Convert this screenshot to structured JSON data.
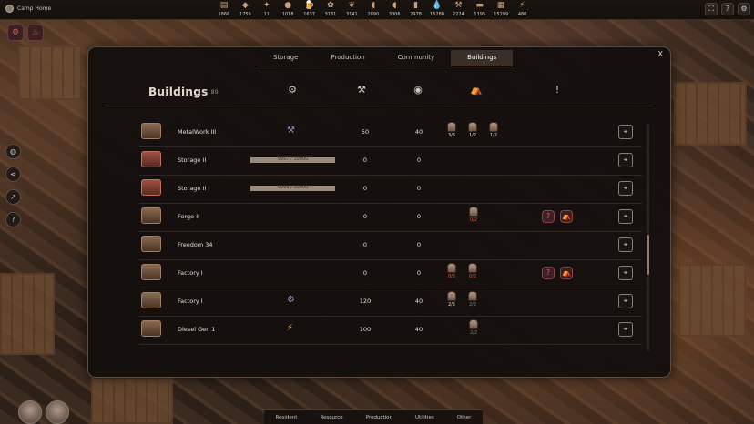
{
  "camp": {
    "name": "Camp Home",
    "icon": "camp-icon"
  },
  "resources": [
    {
      "icon": "wood-icon",
      "value": "1866"
    },
    {
      "icon": "stone-icon",
      "value": "1759"
    },
    {
      "icon": "ore-icon",
      "value": "11"
    },
    {
      "icon": "food-icon",
      "value": "1018"
    },
    {
      "icon": "beer-icon",
      "value": "1637"
    },
    {
      "icon": "herb-icon",
      "value": "3131"
    },
    {
      "icon": "plant-icon",
      "value": "3141"
    },
    {
      "icon": "meat-icon",
      "value": "2890"
    },
    {
      "icon": "meat-icon",
      "value": "3006"
    },
    {
      "icon": "bottle-icon",
      "value": "2978"
    },
    {
      "icon": "water-icon",
      "value": "15280"
    },
    {
      "icon": "tools-icon",
      "value": "2224"
    },
    {
      "icon": "brick-icon",
      "value": "1195"
    },
    {
      "icon": "cloth-icon",
      "value": "15299"
    },
    {
      "icon": "energy-icon",
      "value": "480"
    }
  ],
  "tabs": [
    "Storage",
    "Production",
    "Community",
    "Buildings"
  ],
  "active_tab": "Buildings",
  "panel": {
    "title": "Buildings",
    "count": "89",
    "close_label": "X"
  },
  "rows": [
    {
      "name": "MetalWork III",
      "icon": "metalwork-icon",
      "type_icon": "hammer-pick-icon",
      "bar": null,
      "val1": "50",
      "val2": "40",
      "workers": [
        {
          "label": "3/6",
          "style": "normal"
        },
        {
          "label": "1/2",
          "style": "normal"
        },
        {
          "label": "1/2",
          "style": "normal"
        }
      ],
      "alerts": []
    },
    {
      "name": "Storage II",
      "icon": "storage-icon",
      "type_icon": null,
      "bar": {
        "label": "9957 / 10000",
        "fraction": 0.9957
      },
      "val1": "0",
      "val2": "0",
      "workers": [],
      "alerts": []
    },
    {
      "name": "Storage II",
      "icon": "storage-icon",
      "type_icon": null,
      "bar": {
        "label": "9999 / 10000",
        "fraction": 0.9999
      },
      "val1": "0",
      "val2": "0",
      "workers": [],
      "alerts": []
    },
    {
      "name": "Forge II",
      "icon": "forge-icon",
      "type_icon": null,
      "bar": null,
      "val1": "0",
      "val2": "0",
      "workers": [
        {
          "label": "0/2",
          "style": "red"
        }
      ],
      "alerts": [
        "help-icon",
        "tent-icon"
      ]
    },
    {
      "name": "Freedom 34",
      "icon": "freedom-icon",
      "type_icon": null,
      "bar": null,
      "val1": "0",
      "val2": "0",
      "workers": [],
      "alerts": []
    },
    {
      "name": "Factory I",
      "icon": "factory-icon",
      "type_icon": null,
      "bar": null,
      "val1": "0",
      "val2": "0",
      "workers": [
        {
          "label": "0/5",
          "style": "red"
        },
        {
          "label": "0/2",
          "style": "red"
        }
      ],
      "alerts": [
        "help-icon",
        "tent-icon"
      ]
    },
    {
      "name": "Factory I",
      "icon": "factory-icon",
      "type_icon": "gears-icon",
      "bar": null,
      "val1": "120",
      "val2": "40",
      "workers": [
        {
          "label": "2/5",
          "style": "normal"
        },
        {
          "label": "2/2",
          "style": "dim"
        }
      ],
      "alerts": []
    },
    {
      "name": "Diesel Gen 1",
      "icon": "generator-icon",
      "type_icon": "bolt-icon",
      "bar": null,
      "val1": "100",
      "val2": "40",
      "workers": [
        {
          "label": "2/2",
          "style": "dim"
        }
      ],
      "alerts": []
    }
  ],
  "bottom_tabs": [
    "Resident",
    "Resource",
    "Production",
    "Utilities",
    "Other"
  ]
}
